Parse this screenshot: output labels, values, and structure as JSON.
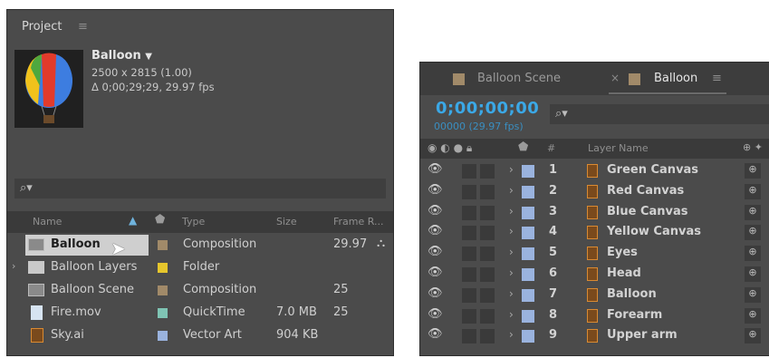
{
  "project": {
    "title": "Project",
    "selected": {
      "name": "Balloon",
      "dimensions": "2500 x 2815 (1.00)",
      "duration": "Δ 0;00;29;29, 29.97 fps"
    },
    "columns": {
      "name": "Name",
      "type": "Type",
      "size": "Size",
      "frame_rate": "Frame R..."
    },
    "items": [
      {
        "name": "Balloon",
        "type": "Composition",
        "size": "",
        "fps": "29.97",
        "label_color": "#a18a69",
        "icon": "composition-icon",
        "selected": true
      },
      {
        "name": "Balloon Layers",
        "type": "Folder",
        "size": "",
        "fps": "",
        "label_color": "#e6c62c",
        "icon": "folder-icon",
        "selected": false
      },
      {
        "name": "Balloon Scene",
        "type": "Composition",
        "size": "",
        "fps": "25",
        "label_color": "#a18a69",
        "icon": "composition-icon",
        "selected": false
      },
      {
        "name": "Fire.mov",
        "type": "QuickTime",
        "size": "7.0 MB",
        "fps": "25",
        "label_color": "#7fc4b4",
        "icon": "video-file-icon",
        "selected": false
      },
      {
        "name": "Sky.ai",
        "type": "Vector Art",
        "size": "904 KB",
        "fps": "",
        "label_color": "#9ab3de",
        "icon": "illustrator-file-icon",
        "selected": false
      }
    ]
  },
  "timeline": {
    "tabs": [
      {
        "label": "Balloon Scene",
        "active": false
      },
      {
        "label": "Balloon",
        "active": true
      }
    ],
    "timecode": "0;00;00;00",
    "frame_info": "00000 (29.97 fps)",
    "column_number": "#",
    "column_layer_name": "Layer Name",
    "layers": [
      {
        "num": "1",
        "name": "Green Canvas"
      },
      {
        "num": "2",
        "name": "Red Canvas"
      },
      {
        "num": "3",
        "name": "Blue Canvas"
      },
      {
        "num": "4",
        "name": "Yellow Canvas"
      },
      {
        "num": "5",
        "name": "Eyes"
      },
      {
        "num": "6",
        "name": "Head"
      },
      {
        "num": "7",
        "name": "Balloon"
      },
      {
        "num": "8",
        "name": "Forearm"
      },
      {
        "num": "9",
        "name": "Upper arm"
      }
    ]
  },
  "colors": {
    "accent_timecode": "#3ba8e6",
    "panel_bg": "#4b4b4b",
    "label_blue": "#9ab3de"
  }
}
